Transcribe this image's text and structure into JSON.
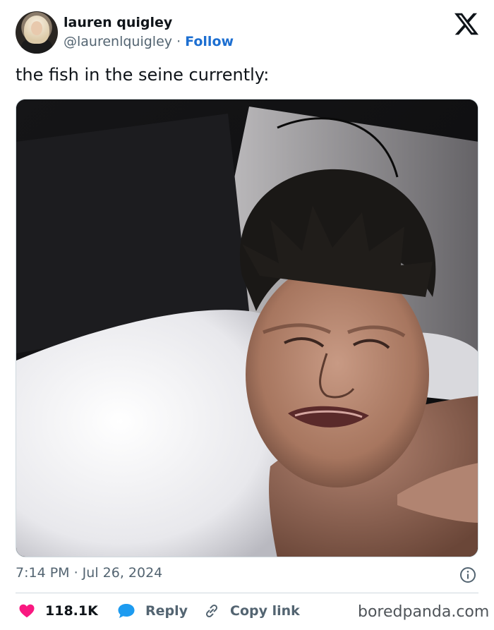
{
  "author": {
    "display_name": "lauren quigley",
    "handle": "@laurenlquigley",
    "separator": " · ",
    "follow_label": "Follow"
  },
  "platform_icon": "x-logo-icon",
  "tweet": {
    "text": "the fish in the seine currently:",
    "timestamp": "7:14 PM · Jul 26, 2024"
  },
  "actions": {
    "likes_count": "118.1K",
    "like_icon": "heart-icon",
    "reply_label": "Reply",
    "reply_icon": "speech-bubble-icon",
    "copy_label": "Copy link",
    "copy_icon": "link-icon"
  },
  "info_icon": "info-icon",
  "watermark": "boredpanda.com",
  "colors": {
    "follow": "#1d6fd1",
    "like_heart": "#f91880",
    "reply_bubble": "#1d9bf0",
    "muted_text": "#536471"
  }
}
